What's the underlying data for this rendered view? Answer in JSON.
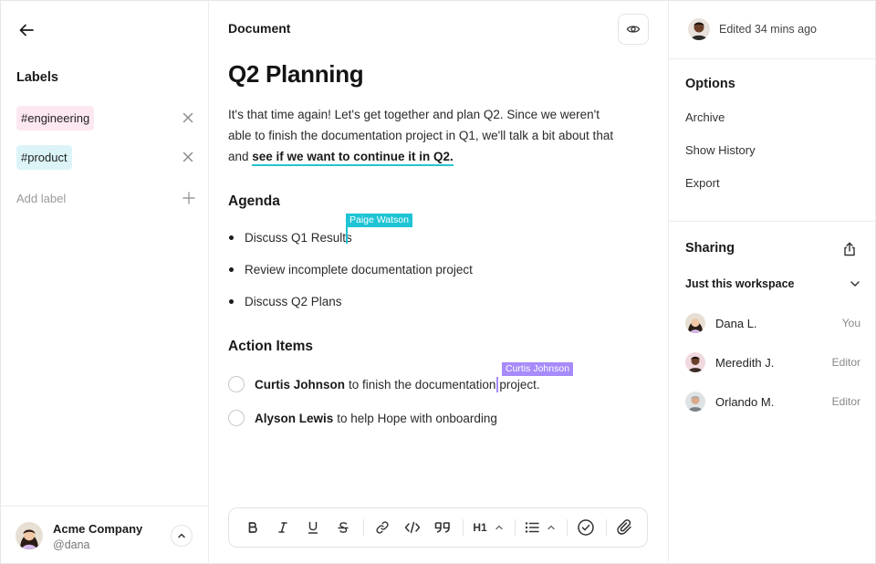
{
  "sidebar": {
    "labels_title": "Labels",
    "labels": [
      {
        "text": "#engineering",
        "color": "#fde8f2"
      },
      {
        "text": "#product",
        "color": "#dcf4f8"
      }
    ],
    "add_label": "Add label",
    "user": {
      "company": "Acme Company",
      "handle": "@dana"
    }
  },
  "document": {
    "header": "Document",
    "title": "Q2 Planning",
    "intro_text": "It's that time again! Let's get together and plan Q2. Since we weren't able to finish the documentation project in Q1, we'll talk a bit about that and ",
    "intro_link": "see if we want to continue it in Q2.",
    "agenda_heading": "Agenda",
    "agenda": [
      "Discuss Q1 Results",
      "Review incomplete documentation project",
      "Discuss Q2 Plans"
    ],
    "cursors": [
      {
        "name": "Paige Watson",
        "color": "#1ec4d4"
      },
      {
        "name": "Curtis Johnson",
        "color": "#a78bfa"
      }
    ],
    "action_heading": "Action Items",
    "actions": [
      {
        "person": "Curtis Johnson",
        "text_before_cursor": "to finish the documentation ",
        "text_after_cursor": "project."
      },
      {
        "person": "Alyson Lewis",
        "text": "to help Hope with onboarding"
      }
    ],
    "toolbar": {
      "items": [
        "bold-icon",
        "italic-icon",
        "underline-icon",
        "strikethrough-icon",
        "link-icon",
        "code-icon",
        "quote-icon",
        "heading-dropdown",
        "list-dropdown",
        "checklist-icon",
        "attachment-icon"
      ],
      "heading_label": "H1"
    }
  },
  "right_panel": {
    "edited": "Edited 34 mins ago",
    "options_title": "Options",
    "options": [
      "Archive",
      "Show History",
      "Export"
    ],
    "sharing_title": "Sharing",
    "scope": "Just this workspace",
    "members": [
      {
        "name": "Dana L.",
        "role": "You"
      },
      {
        "name": "Meredith J.",
        "role": "Editor"
      },
      {
        "name": "Orlando M.",
        "role": "Editor"
      }
    ]
  }
}
